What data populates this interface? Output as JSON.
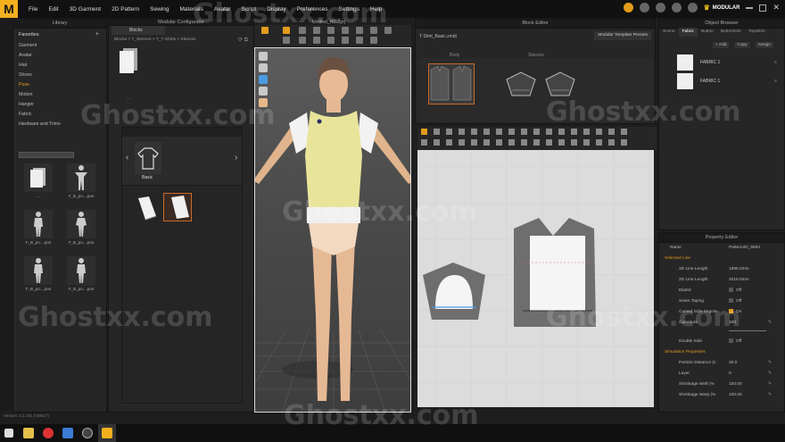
{
  "app": {
    "logo_letter": "M",
    "window_title": "Untitled_HD.Zprj",
    "menu": [
      "File",
      "Edit",
      "3D Garment",
      "2D Pattern",
      "Sewing",
      "Materials",
      "Avatar",
      "Script",
      "Display",
      "Preferences",
      "Settings",
      "Help"
    ],
    "mode_label": "MODULAR",
    "version_text": "Version: 4.1.331 (r39627)",
    "accent_color": "#e39b1a"
  },
  "library": {
    "title": "Library",
    "favorites_label": "Favorites",
    "items": [
      "Garment",
      "Avatar",
      "Hair",
      "Shoes",
      "Pose",
      "Motion",
      "Hanger",
      "Fabric",
      "Hardware and Trims"
    ],
    "active_item": "Pose",
    "thumbs": [
      "...",
      "F_B_po....pos",
      "F_B_po....pos",
      "F_B_po....pos",
      "F_B_po....pos",
      "F_B_po....pos"
    ]
  },
  "modular_configurator": {
    "title": "Modular Configurator",
    "tab": "Blocks",
    "breadcrumb": "Blocks > T_Women > T_T-Shirts > Sleeves",
    "file_label": "...",
    "basic_label": "Basic"
  },
  "block_editor": {
    "title": "Block Editor",
    "file": "T-Shirt_Basic.zmdl",
    "presets_button": "Modular Template Presets",
    "body_label": "Body",
    "sleeves_label": "Sleeves"
  },
  "object_browser": {
    "title": "Object Browser",
    "tabs": [
      "Scene",
      "Fabric",
      "Button",
      "Buttonhole",
      "Topstitch"
    ],
    "active_tab": "Fabric",
    "add_label": "+ Add",
    "copy_label": "Copy",
    "assign_label": "Assign",
    "fabrics": [
      "FABRIC 1",
      "FABRIC 1"
    ]
  },
  "property_editor": {
    "title": "Property Editor",
    "name_label": "Name",
    "name_value": "Pattern2D_6663",
    "selected_line_label": "Selected Line",
    "line_3d_length_label": "3D Line Length",
    "line_3d_length_value": "1896.0mm",
    "line_2d_length_label": "2D Line Length",
    "line_2d_length_value": "2016.0mm",
    "elastic_label": "Elastic",
    "elastic_value": "Off",
    "seam_taping_label": "Seam Taping",
    "seam_taping_value": "Off",
    "curved_side_label": "Curved Side Segme",
    "curved_side_value": "On",
    "curvature_label": "Curvature",
    "curvature_value": "100",
    "double_side_label": "Double Side",
    "double_side_value": "Off",
    "simulation_label": "Simulation Properties",
    "particle_distance_label": "Particle Distance (n",
    "particle_distance_value": "20.0",
    "layer_label": "Layer",
    "layer_value": "0",
    "shrinkage_weft_label": "Shrinkage Weft (%",
    "shrinkage_weft_value": "100.00",
    "shrinkage_warp_label": "Shrinkage Warp (%",
    "shrinkage_warp_value": "100.00"
  },
  "watermark": "Ghostxx.com"
}
